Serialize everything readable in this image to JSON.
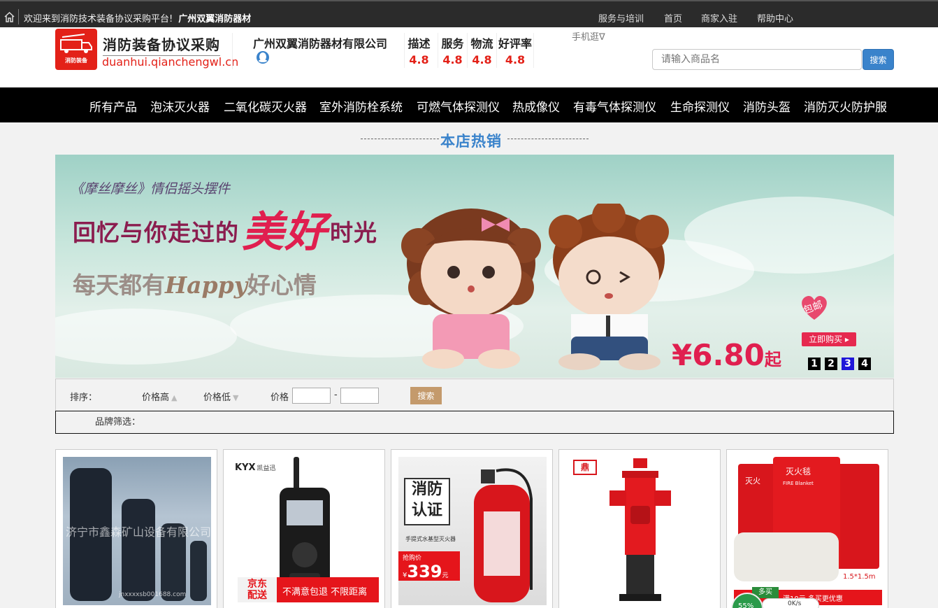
{
  "topbar": {
    "welcome": "欢迎来到消防技术装备协议采购平台!",
    "shop": "广州双翼消防器材",
    "links": [
      "服务与培训",
      "首页",
      "商家入驻",
      "帮助中心"
    ]
  },
  "header": {
    "logo_caption": "消防装备",
    "logo_title": "消防装备协议采购",
    "logo_url": "duanhui.qianchengwl.cn",
    "shop_name": "广州双翼消防器材有限公司",
    "ratings": [
      {
        "label": "描述",
        "value": "4.8"
      },
      {
        "label": "服务",
        "value": "4.8"
      },
      {
        "label": "物流",
        "value": "4.8"
      },
      {
        "label": "好评率",
        "value": "4.8"
      }
    ],
    "mobile": "手机逛∇",
    "search_placeholder": "请输入商品名",
    "search_button": "搜索"
  },
  "nav": [
    "所有产品",
    "泡沫灭火器",
    "二氧化碳灭火器",
    "室外消防栓系统",
    "可燃气体探测仪",
    "热成像仪",
    "有毒气体探测仪",
    "生命探测仪",
    "消防头盔",
    "消防灭火防护服"
  ],
  "hot_title": "本店热销",
  "banner": {
    "sub": "《摩丝摩丝》情侣摇头摆件",
    "main_a": "回忆与你走过的",
    "main_big": "美好",
    "main_b": "时光",
    "happy_a": "每天都有",
    "happy_b": "Happy",
    "happy_c": "好心情",
    "badge": "包邮",
    "buy": "立即购买 ▸",
    "price": "¥6.80",
    "price_suffix": "起",
    "dots": [
      "1",
      "2",
      "3",
      "4"
    ],
    "active_dot": 2
  },
  "filter": {
    "sort_label": "排序：",
    "price_high": "价格高",
    "price_low": "价格低",
    "price_label": "价格",
    "range_sep": "-",
    "search_button": "搜索",
    "brand_label": "品牌筛选："
  },
  "products": [
    {
      "image_text": "济宁市鑫森矿山设备有限公司",
      "watermark": "jnxxxxsb001688.com"
    },
    {
      "brand": "KYX",
      "brand_cn": "凯益迅",
      "promo_a": "京东",
      "promo_b": "配送",
      "promo_c": "不满意包退 不限距离"
    },
    {
      "title_a": "消防",
      "title_b": "认证",
      "caption": "手提式水基型灭火器",
      "price_label": "抢购价",
      "price": "339",
      "price_unit": "元"
    },
    {
      "brand_mark": "鼎"
    },
    {
      "label_a": "灭火",
      "label_b": "灭火毯",
      "en": "FIRE Blanket",
      "size": "1.5*1.5m",
      "promo": "满10元 多买更优惠",
      "tag": "多买"
    }
  ],
  "speed": {
    "percent": "55%",
    "rate": "0K/s"
  },
  "colors": {
    "accent": "#3a83cb",
    "brand_red": "#e32118",
    "nav_bg": "#000000",
    "filter_btn": "#c49a6c"
  }
}
